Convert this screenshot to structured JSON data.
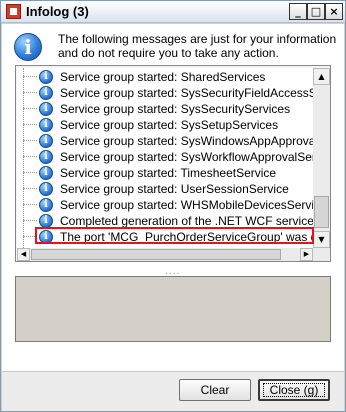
{
  "window": {
    "title": "Infolog (3)",
    "controls": {
      "minimize": "_",
      "maximize": "□",
      "close": "×"
    }
  },
  "intro": {
    "text": "The following messages are just for your information and do not require you to take any action."
  },
  "messages": [
    {
      "text": "Service group started: SharedServices",
      "icon": "info-icon"
    },
    {
      "text": "Service group started: SysSecurityFieldAccessServic",
      "icon": "info-icon"
    },
    {
      "text": "Service group started: SysSecurityServices",
      "icon": "info-icon"
    },
    {
      "text": "Service group started: SysSetupServices",
      "icon": "info-icon"
    },
    {
      "text": "Service group started: SysWindowsAppApprovalsSer",
      "icon": "info-icon"
    },
    {
      "text": "Service group started: SysWorkflowApprovalService",
      "icon": "info-icon"
    },
    {
      "text": "Service group started: TimesheetService",
      "icon": "info-icon"
    },
    {
      "text": "Service group started: UserSessionService",
      "icon": "info-icon"
    },
    {
      "text": "Service group started: WHSMobileDevicesServices",
      "icon": "info-icon"
    },
    {
      "text": "Completed generation of the .NET WCF service artif",
      "icon": "info-icon"
    },
    {
      "text": "The port 'MCG_PurchOrderServiceGroup' was deploy",
      "icon": "info-icon",
      "highlighted": true
    }
  ],
  "highlight_color": "#e8101a",
  "splitter_grip": "....",
  "buttons": {
    "clear": "Clear",
    "close": "Close (g)"
  }
}
